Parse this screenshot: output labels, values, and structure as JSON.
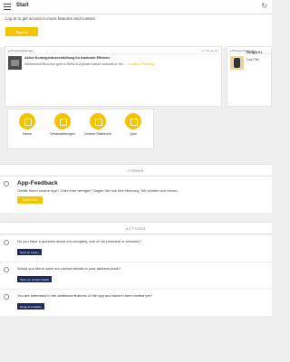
{
  "header": {
    "title": "Start",
    "menu_icon": "hamburger-icon",
    "refresh_icon": "refresh-icon"
  },
  "login": {
    "text": "Log in to get access to more features and content",
    "button": "Sign in"
  },
  "news": [
    {
      "category": "Pressemitteilungen",
      "time": "vor Monat Tag",
      "title": "Aktive Kurbelgehäuseentlüftung für maximale Effizienz",
      "text": "Weltneuheit Bluo.tron geht in BMW 6-Zylinder-Diesel erstmals in Ser ...",
      "link": "Continue Reading"
    },
    {
      "category": "Pressemitteilungen",
      "title": "Hengst Kr",
      "text": "Das Filte"
    }
  ],
  "tiles": [
    {
      "label": "News"
    },
    {
      "label": "Veranstaltungen"
    },
    {
      "label": "Unsere Standorte"
    },
    {
      "label": "Quiz"
    }
  ],
  "forms": {
    "heading": "FORMS",
    "title": "App-Feedback",
    "text": "Gefällt Ihnen unsere App? Oder eher weniger? Sagen Sie uns Ihre Meinung. Wir würden uns freuen.",
    "button": "Submit Now"
  },
  "actions": {
    "heading": "ACTIONS",
    "items": [
      {
        "text": "Do you have a question about our company, one of our products or services?",
        "button": "Send an inquiry"
      },
      {
        "text": "Would you like to save our contact details in your address book?",
        "button": "Save our contact details"
      },
      {
        "text": "You are interested in the additional features of the app and haven't been invited yet?",
        "button": "Request invitation"
      }
    ]
  },
  "colors": {
    "accent": "#f5c400",
    "button_dark": "#1d2b5c",
    "background": "#efefef"
  }
}
